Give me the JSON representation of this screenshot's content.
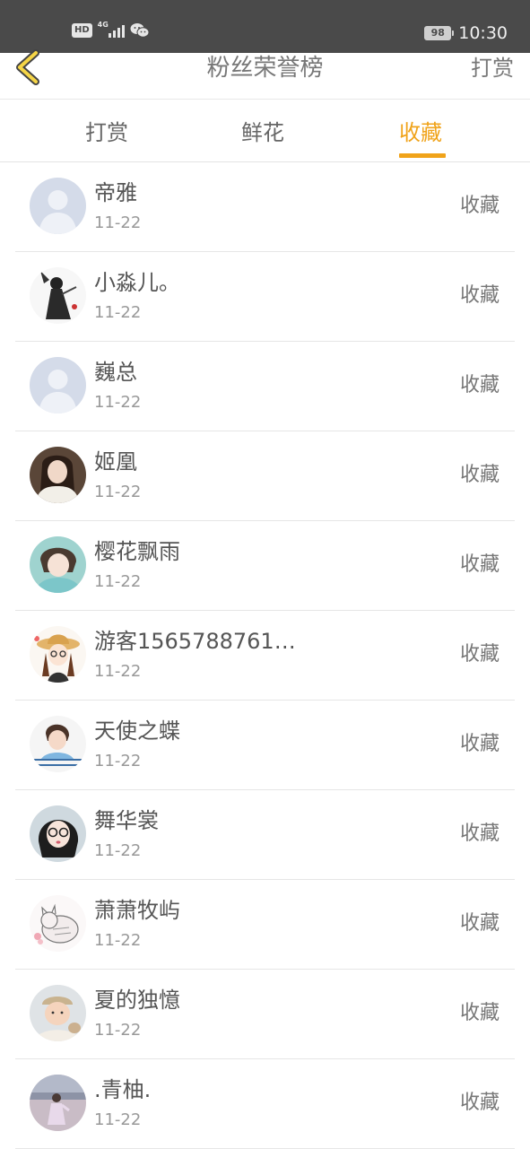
{
  "status_bar": {
    "hd": "HD",
    "network": "4G",
    "battery": "98",
    "time": "10:30"
  },
  "header": {
    "title": "粉丝荣誉榜",
    "right_action": "打赏"
  },
  "tabs": [
    {
      "label": "打赏",
      "active": false
    },
    {
      "label": "鲜花",
      "active": false
    },
    {
      "label": "收藏",
      "active": true
    }
  ],
  "colors": {
    "accent": "#f0a31a",
    "status_bar_bg": "#4a4a4a"
  },
  "fans": [
    {
      "name": "帝雅",
      "date": "11-22",
      "action": "收藏",
      "avatar": "default-avatar-icon"
    },
    {
      "name": "小淼儿。",
      "date": "11-22",
      "action": "收藏",
      "avatar": "ink-girl-avatar"
    },
    {
      "name": "巍总",
      "date": "11-22",
      "action": "收藏",
      "avatar": "default-avatar-icon"
    },
    {
      "name": "姬凰",
      "date": "11-22",
      "action": "收藏",
      "avatar": "girl-photo-avatar"
    },
    {
      "name": "樱花飘雨",
      "date": "11-22",
      "action": "收藏",
      "avatar": "girl-teal-avatar"
    },
    {
      "name": "游客1565788761…",
      "date": "11-22",
      "action": "收藏",
      "avatar": "cartoon-hat-girl-avatar"
    },
    {
      "name": "天使之蝶",
      "date": "11-22",
      "action": "收藏",
      "avatar": "kid-photo-avatar"
    },
    {
      "name": "舞华裳",
      "date": "11-22",
      "action": "收藏",
      "avatar": "glasses-girl-avatar"
    },
    {
      "name": "萧萧牧屿",
      "date": "11-22",
      "action": "收藏",
      "avatar": "cat-sketch-avatar"
    },
    {
      "name": "夏的独憶",
      "date": "11-22",
      "action": "收藏",
      "avatar": "baby-photo-avatar"
    },
    {
      "name": ".青柚.",
      "date": "11-22",
      "action": "收藏",
      "avatar": "beach-girl-avatar"
    }
  ]
}
